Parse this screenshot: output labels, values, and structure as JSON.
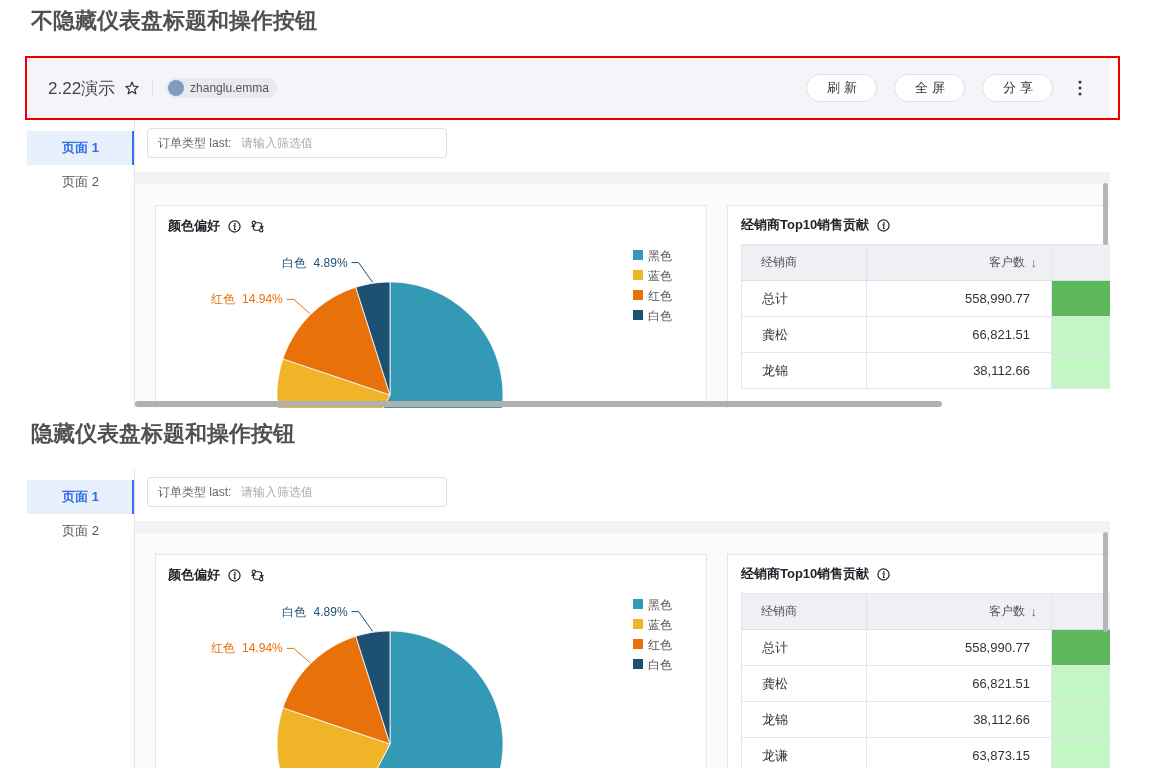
{
  "sections": [
    {
      "heading": "不隐藏仪表盘标题和操作按钮",
      "dashboard_header": {
        "highlighted": true,
        "title": "2.22演示",
        "starred": false,
        "owner": "zhanglu.emma",
        "buttons": [
          "刷新",
          "全屏",
          "分享"
        ]
      },
      "pages": [
        {
          "label": "页面 1",
          "selected": true
        },
        {
          "label": "页面 2",
          "selected": false
        }
      ],
      "filter": {
        "label": "订单类型 last:",
        "placeholder": "请输入筛选值"
      },
      "pie_card": {
        "title": "颜色偏好",
        "slices": [
          {
            "color": "#3399b4"
          },
          {
            "color": "#f0b429"
          },
          {
            "color": "#e8710a",
            "callout": {
              "label": "红色",
              "value": "14.94%"
            }
          },
          {
            "color": "#1e5072",
            "callout": {
              "label": "白色",
              "value": "4.89%"
            }
          }
        ],
        "legend": [
          {
            "label": "黑色",
            "color": "#3399b4"
          },
          {
            "label": "蓝色",
            "color": "#f0b429"
          },
          {
            "label": "红色",
            "color": "#e8710a"
          },
          {
            "label": "白色",
            "color": "#1e5072"
          }
        ]
      },
      "table_card": {
        "title": "经销商Top10销售贡献",
        "columns": [
          {
            "label": "经销商"
          },
          {
            "label": "客户数",
            "sort_mark": "↓"
          }
        ],
        "rows": [
          {
            "dealer": "总计",
            "customers": "558,990.77",
            "column_3": {
              "color": "#5cb85a"
            }
          },
          {
            "dealer": "龚松",
            "customers": "66,821.51",
            "column_3": {
              "color": "#c4f5c4"
            }
          },
          {
            "dealer": "龙锦",
            "customers": "38,112.66",
            "column_3": {
              "color": "#c4f5c4"
            }
          }
        ]
      }
    },
    {
      "heading": "隐藏仪表盘标题和操作按钮",
      "pages": [
        {
          "label": "页面 1",
          "selected": true
        },
        {
          "label": "页面 2",
          "selected": false
        }
      ],
      "filter": {
        "label": "订单类型 last:",
        "placeholder": "请输入筛选值"
      },
      "pie_card": {
        "title": "颜色偏好",
        "slices": [
          {
            "color": "#3399b4"
          },
          {
            "color": "#f0b429"
          },
          {
            "color": "#e8710a",
            "callout": {
              "label": "红色",
              "value": "14.94%"
            }
          },
          {
            "color": "#1e5072",
            "callout": {
              "label": "白色",
              "value": "4.89%"
            }
          }
        ],
        "legend": [
          {
            "label": "黑色",
            "color": "#3399b4"
          },
          {
            "label": "蓝色",
            "color": "#f0b429"
          },
          {
            "label": "红色",
            "color": "#e8710a"
          },
          {
            "label": "白色",
            "color": "#1e5072"
          }
        ]
      },
      "table_card": {
        "title": "经销商Top10销售贡献",
        "columns": [
          {
            "label": "经销商"
          },
          {
            "label": "客户数",
            "sort_mark": "↓"
          }
        ],
        "rows": [
          {
            "dealer": "总计",
            "customers": "558,990.77",
            "column_3": {
              "color": "#5cb85a"
            }
          },
          {
            "dealer": "龚松",
            "customers": "66,821.51",
            "column_3": {
              "color": "#c4f5c4"
            }
          },
          {
            "dealer": "龙锦",
            "customers": "38,112.66",
            "column_3": {
              "color": "#c4f5c4"
            }
          },
          {
            "dealer": "龙谦",
            "customers": "63,873.15",
            "column_3": {
              "color": "#c4f5c4"
            }
          }
        ]
      }
    }
  ]
}
